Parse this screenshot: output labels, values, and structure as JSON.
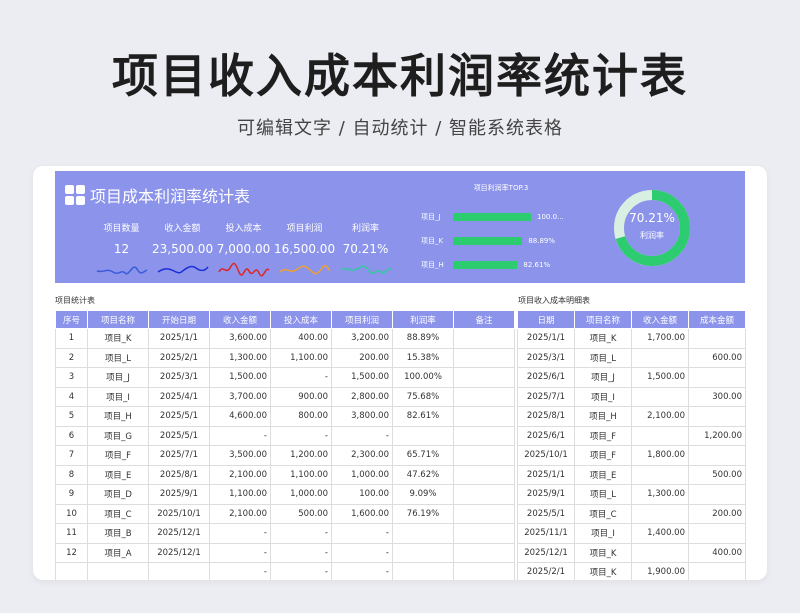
{
  "page": {
    "title": "项目收入成本利润率统计表",
    "subtitle": "可编辑文字 / 自动统计 / 智能系统表格"
  },
  "banner": {
    "title": "项目成本利润率统计表",
    "kpis": [
      {
        "label": "项目数量",
        "value": "12",
        "color": "#3b5bdb"
      },
      {
        "label": "收入金额",
        "value": "23,500.00",
        "color": "#1c2ed8"
      },
      {
        "label": "投入成本",
        "value": "7,000.00",
        "color": "#e02424"
      },
      {
        "label": "项目利润",
        "value": "16,500.00",
        "color": "#f0a030"
      },
      {
        "label": "利润率",
        "value": "70.21%",
        "color": "#35c9a0"
      }
    ],
    "top3": {
      "title": "项目利润率TOP.3",
      "items": [
        {
          "name": "项目_J",
          "value": "100.0...",
          "pct": 1.0
        },
        {
          "name": "项目_K",
          "value": "88.89%",
          "pct": 0.8889
        },
        {
          "name": "项目_H",
          "value": "82.61%",
          "pct": 0.8261
        }
      ],
      "bar_color": "#2ecc71"
    },
    "donut": {
      "value": "70.21%",
      "label": "利润率",
      "fraction": 0.7021,
      "color": "#2ecc71",
      "track_color": "#d9efe2"
    }
  },
  "left_table": {
    "title": "项目统计表",
    "headers": [
      "序号",
      "项目名称",
      "开始日期",
      "收入金额",
      "投入成本",
      "项目利润",
      "利润率",
      "备注"
    ],
    "rows": [
      [
        "1",
        "项目_K",
        "2025/1/1",
        "3,600.00",
        "400.00",
        "3,200.00",
        "88.89%",
        ""
      ],
      [
        "2",
        "项目_L",
        "2025/2/1",
        "1,300.00",
        "1,100.00",
        "200.00",
        "15.38%",
        ""
      ],
      [
        "3",
        "项目_J",
        "2025/3/1",
        "1,500.00",
        "-",
        "1,500.00",
        "100.00%",
        ""
      ],
      [
        "4",
        "项目_I",
        "2025/4/1",
        "3,700.00",
        "900.00",
        "2,800.00",
        "75.68%",
        ""
      ],
      [
        "5",
        "项目_H",
        "2025/5/1",
        "4,600.00",
        "800.00",
        "3,800.00",
        "82.61%",
        ""
      ],
      [
        "6",
        "项目_G",
        "2025/5/1",
        "-",
        "-",
        "-",
        "",
        ""
      ],
      [
        "7",
        "项目_F",
        "2025/7/1",
        "3,500.00",
        "1,200.00",
        "2,300.00",
        "65.71%",
        ""
      ],
      [
        "8",
        "项目_E",
        "2025/8/1",
        "2,100.00",
        "1,100.00",
        "1,000.00",
        "47.62%",
        ""
      ],
      [
        "9",
        "项目_D",
        "2025/9/1",
        "1,100.00",
        "1,000.00",
        "100.00",
        "9.09%",
        ""
      ],
      [
        "10",
        "项目_C",
        "2025/10/1",
        "2,100.00",
        "500.00",
        "1,600.00",
        "76.19%",
        ""
      ],
      [
        "11",
        "项目_B",
        "2025/12/1",
        "-",
        "-",
        "-",
        "",
        ""
      ],
      [
        "12",
        "项目_A",
        "2025/12/1",
        "-",
        "-",
        "-",
        "",
        ""
      ],
      [
        "",
        "",
        "",
        "-",
        "-",
        "-",
        "",
        ""
      ]
    ]
  },
  "right_table": {
    "title": "项目收入成本明细表",
    "headers": [
      "日期",
      "项目名称",
      "收入金额",
      "成本金额"
    ],
    "rows": [
      [
        "2025/1/1",
        "项目_K",
        "1,700.00",
        ""
      ],
      [
        "2025/3/1",
        "项目_L",
        "",
        "600.00"
      ],
      [
        "2025/6/1",
        "项目_J",
        "1,500.00",
        ""
      ],
      [
        "2025/7/1",
        "项目_I",
        "",
        "300.00"
      ],
      [
        "2025/8/1",
        "项目_H",
        "2,100.00",
        ""
      ],
      [
        "2025/6/1",
        "项目_F",
        "",
        "1,200.00"
      ],
      [
        "2025/10/1",
        "项目_F",
        "1,800.00",
        ""
      ],
      [
        "2025/1/1",
        "项目_E",
        "",
        "500.00"
      ],
      [
        "2025/9/1",
        "项目_L",
        "1,300.00",
        ""
      ],
      [
        "2025/5/1",
        "项目_C",
        "",
        "200.00"
      ],
      [
        "2025/11/1",
        "项目_I",
        "1,400.00",
        ""
      ],
      [
        "2025/12/1",
        "项目_K",
        "",
        "400.00"
      ],
      [
        "2025/2/1",
        "项目_K",
        "1,900.00",
        ""
      ]
    ]
  }
}
